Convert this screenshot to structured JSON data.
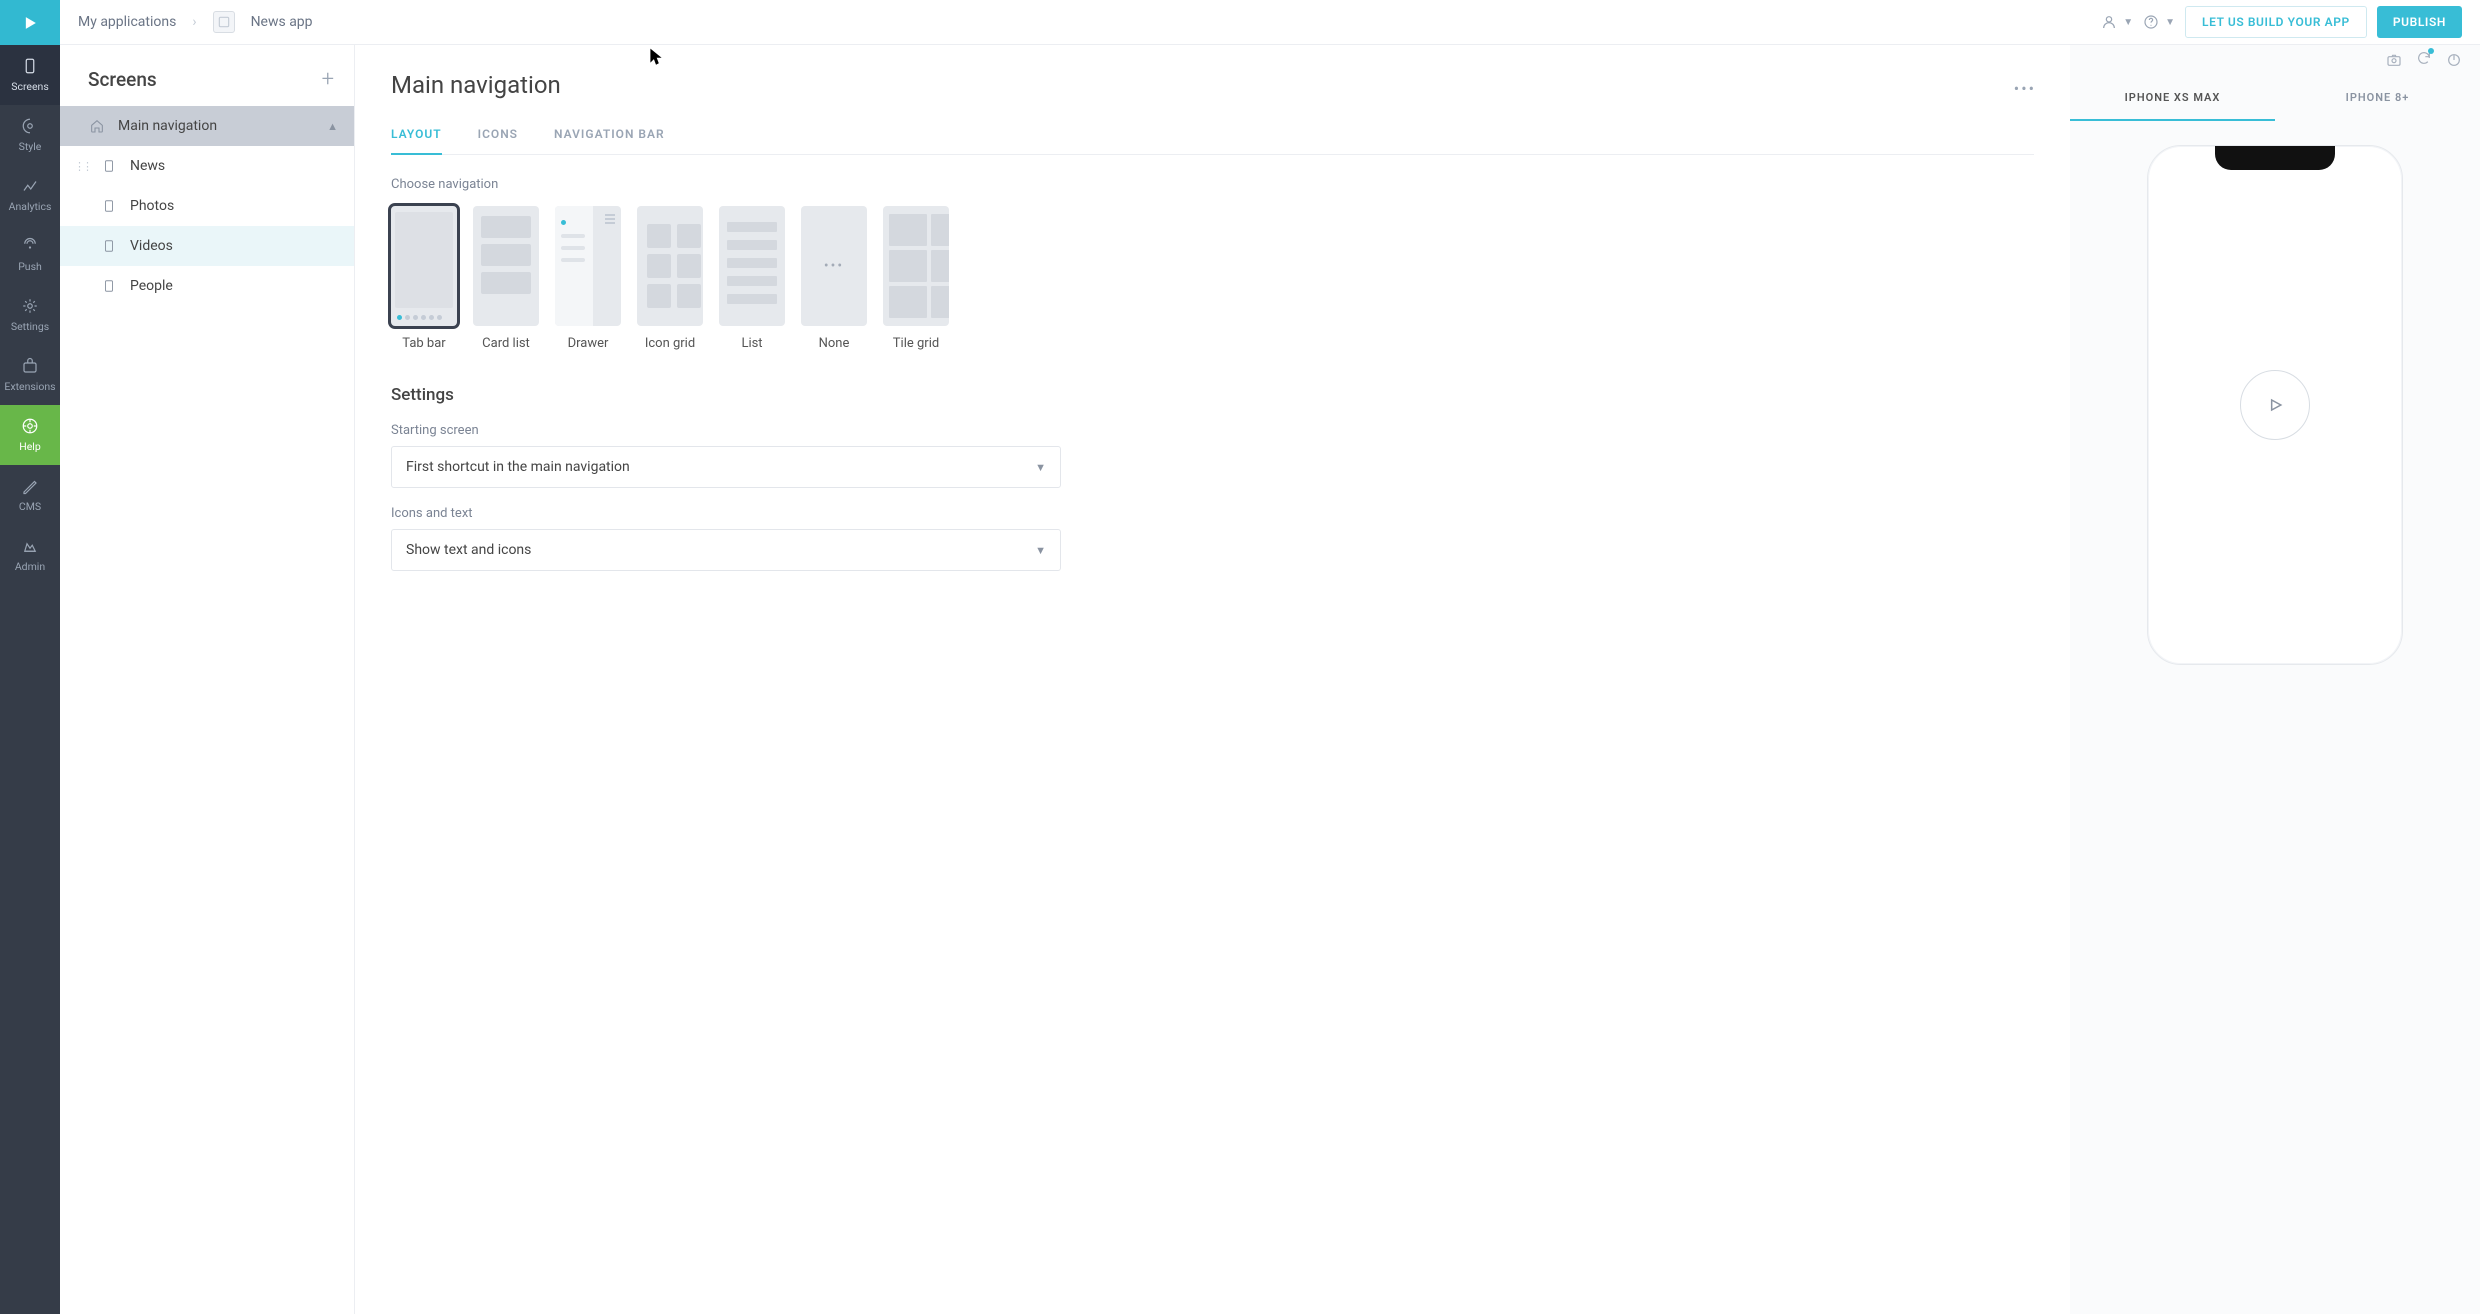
{
  "breadcrumb": {
    "root": "My applications",
    "app": "News app"
  },
  "topbar": {
    "build_btn": "LET US BUILD YOUR APP",
    "publish_btn": "PUBLISH"
  },
  "rail": {
    "items": [
      {
        "label": "Screens"
      },
      {
        "label": "Style"
      },
      {
        "label": "Analytics"
      },
      {
        "label": "Push"
      },
      {
        "label": "Settings"
      },
      {
        "label": "Extensions"
      },
      {
        "label": "Help"
      },
      {
        "label": "CMS"
      },
      {
        "label": "Admin"
      }
    ]
  },
  "sidepanel": {
    "title": "Screens",
    "root": "Main navigation",
    "items": [
      "News",
      "Photos",
      "Videos",
      "People"
    ]
  },
  "main": {
    "title": "Main navigation",
    "tabs": [
      "LAYOUT",
      "ICONS",
      "NAVIGATION BAR"
    ],
    "choose_label": "Choose navigation",
    "nav_options": [
      "Tab bar",
      "Card list",
      "Drawer",
      "Icon grid",
      "List",
      "None",
      "Tile grid"
    ],
    "settings_heading": "Settings",
    "starting_screen_label": "Starting screen",
    "starting_screen_value": "First shortcut in the main navigation",
    "icons_text_label": "Icons and text",
    "icons_text_value": "Show text and icons"
  },
  "preview": {
    "device_tabs": [
      "IPHONE XS MAX",
      "IPHONE 8+"
    ]
  }
}
